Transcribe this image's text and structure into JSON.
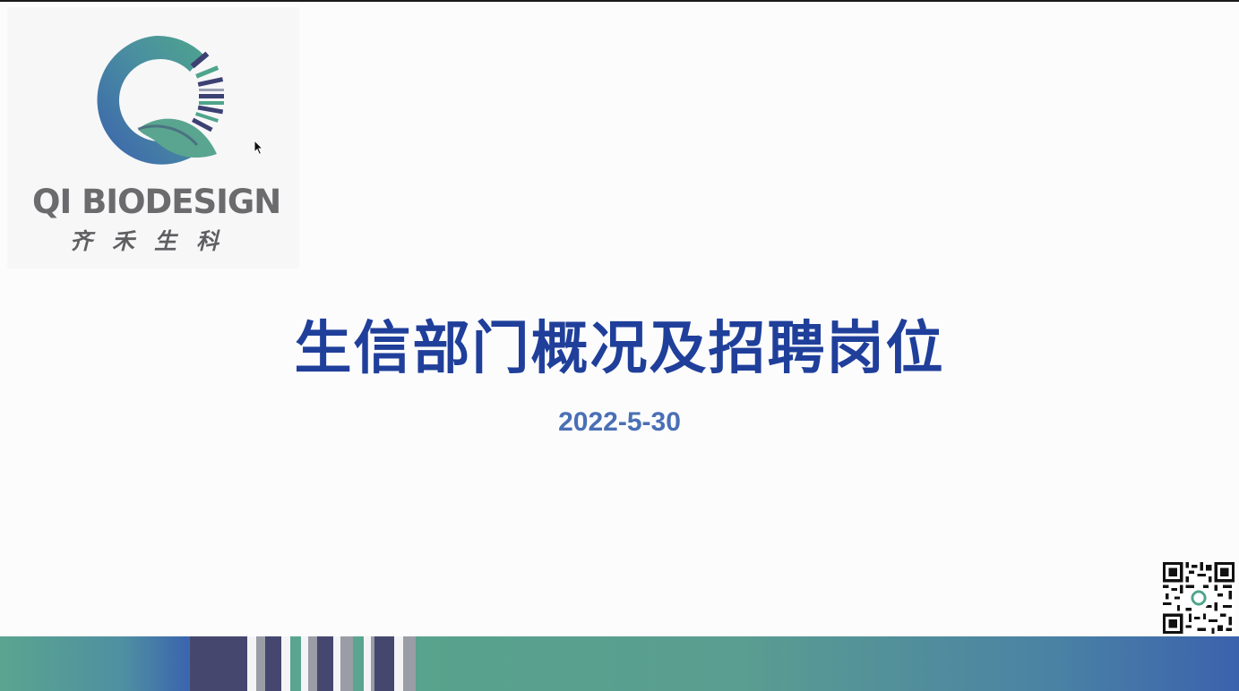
{
  "brand": {
    "name_en": "QI BIODESIGN",
    "name_cn": "齐禾生科",
    "colors": {
      "logo_teal": "#4ea58c",
      "logo_blue": "#3b62ad",
      "logo_navy": "#3c4173"
    }
  },
  "slide": {
    "title": "生信部门概况及招聘岗位",
    "date": "2022-5-30",
    "title_color": "#1f3f9a",
    "date_color": "#4a6fb5"
  },
  "icons": {
    "cursor": "mouse-pointer-icon",
    "qr": "qr-code-icon"
  }
}
